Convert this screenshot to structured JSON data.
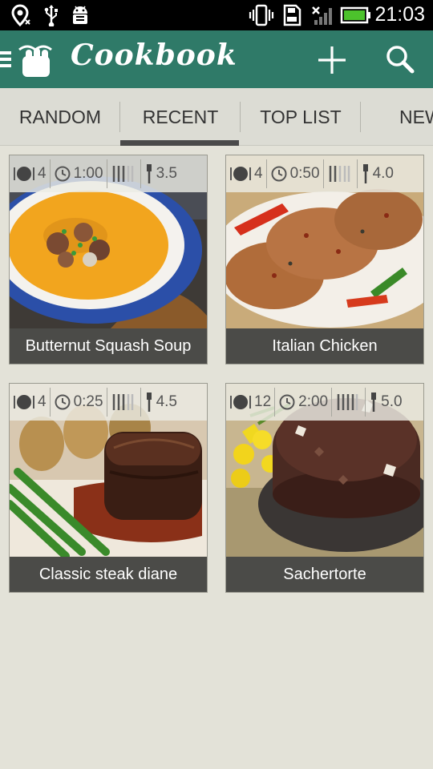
{
  "status_bar": {
    "time": "21:03",
    "icons": [
      "location-icon",
      "usb-icon",
      "android-debug-icon",
      "vibrate-icon",
      "sd-card-icon",
      "no-signal-icon",
      "battery-icon"
    ]
  },
  "action_bar": {
    "title": "Cookbook",
    "icons": [
      "menu-icon",
      "app-logo-icon",
      "add-icon",
      "search-icon"
    ]
  },
  "tabs": [
    {
      "label": "RANDOM",
      "selected": false
    },
    {
      "label": "RECENT",
      "selected": true
    },
    {
      "label": "TOP LIST",
      "selected": false
    },
    {
      "label": "NEW",
      "selected": false
    }
  ],
  "recipes": [
    {
      "name": "Butternut Squash Soup",
      "servings": "4",
      "time": "1:00",
      "rating": "3.5"
    },
    {
      "name": "Italian Chicken",
      "servings": "4",
      "time": "0:50",
      "rating": "4.0"
    },
    {
      "name": "Classic steak diane",
      "servings": "4",
      "time": "0:25",
      "rating": "4.5"
    },
    {
      "name": "Sachertorte",
      "servings": "12",
      "time": "2:00",
      "rating": "5.0"
    }
  ],
  "colors": {
    "action_bar": "#2f7a68",
    "background": "#e3e2d8",
    "caption": "#4b4b48",
    "tab_indicator": "#4a4a4a"
  }
}
